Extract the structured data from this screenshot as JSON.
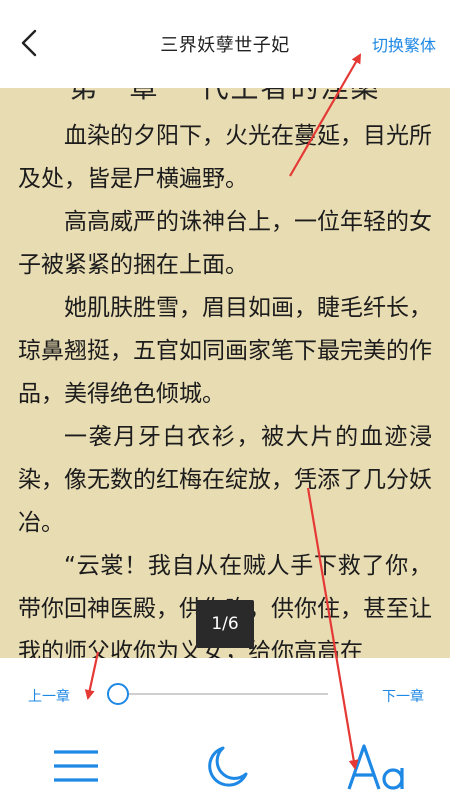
{
  "header": {
    "title": "三界妖孽世子妃",
    "switch_label": "切换繁体"
  },
  "reader": {
    "chapter_heading": "第一章 一代王者的涅槃",
    "paragraphs": [
      "血染的夕阳下，火光在蔓延，目光所及处，皆是尸横遍野。",
      "高高威严的诛神台上，一位年轻的女子被紧紧的捆在上面。",
      "她肌肤胜雪，眉目如画，睫毛纤长，琼鼻翘挺，五官如同画家笔下最完美的作品，美得绝色倾城。",
      "一袭月牙白衣衫，被大片的血迹浸染，像无数的红梅在绽放，凭添了几分妖冶。",
      "“云裳！我自从在贼人手下救了你，带你回神医殿，供你吃，供你住，甚至让我的师父收你为义女，给你高高在"
    ],
    "page_indicator": "1/6"
  },
  "controls": {
    "prev_chapter": "上一章",
    "next_chapter": "下一章",
    "progress": 0.0
  },
  "colors": {
    "accent": "#1e88e5",
    "paper": "#e8dcb3",
    "annotation_arrow": "#e53935"
  }
}
